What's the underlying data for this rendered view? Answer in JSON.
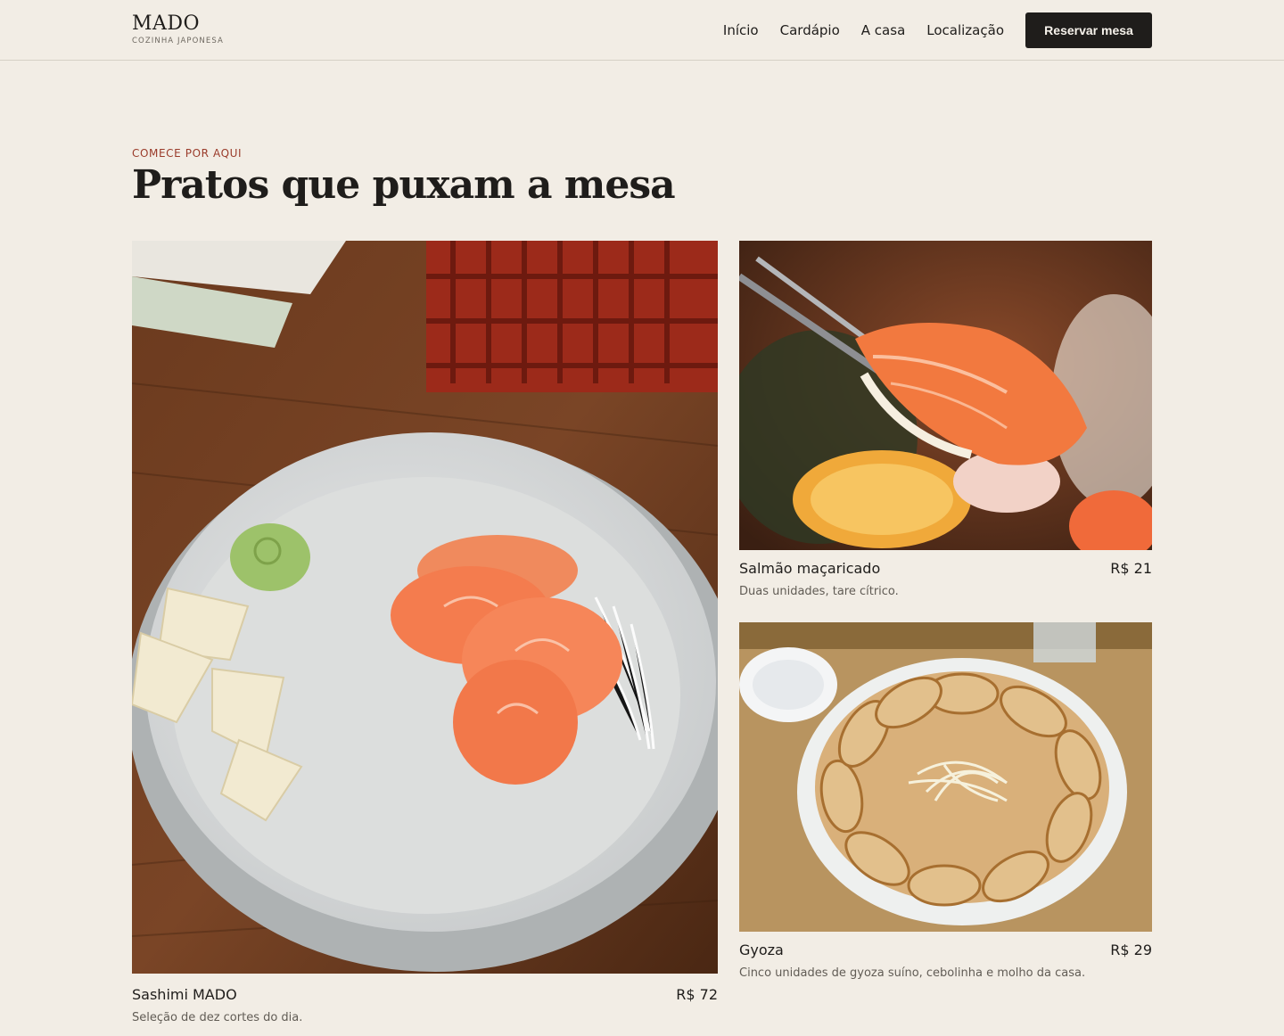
{
  "brand": {
    "name": "MADO",
    "tagline": "COZINHA JAPONESA"
  },
  "nav": {
    "links": [
      "Início",
      "Cardápio",
      "A casa",
      "Localização"
    ],
    "cta_label": "Reservar mesa"
  },
  "section": {
    "eyebrow": "COMECE POR AQUI",
    "title": "Pratos que puxam a mesa"
  },
  "dishes": [
    {
      "name": "Sashimi MADO",
      "price": "R$ 72",
      "description": "Seleção de dez cortes do dia."
    },
    {
      "name": "Salmão maçaricado",
      "price": "R$ 21",
      "description": "Duas unidades, tare cítrico."
    },
    {
      "name": "Gyoza",
      "price": "R$ 29",
      "description": "Cinco unidades de gyoza suíno, cebolinha e molho da casa."
    }
  ],
  "colors": {
    "background": "#f2ede5",
    "ink": "#1f1d1b",
    "accent": "#9a3b2a",
    "muted": "#615c55"
  }
}
